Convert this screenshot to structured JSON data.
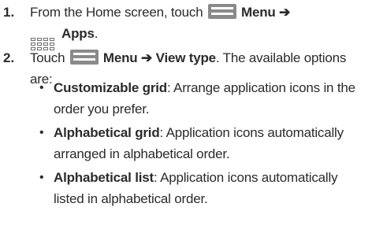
{
  "steps": [
    {
      "number": "1.",
      "text_before": "From the Home screen, touch",
      "menu_label": "Menu",
      "arrow": "➔",
      "apps_label": "Apps",
      "end": "."
    },
    {
      "number": "2.",
      "text_before": "Touch",
      "menu_label": "Menu",
      "arrow": "➔",
      "view_type": "View type",
      "text_after": ". The available options are:"
    }
  ],
  "options": [
    {
      "title": "Customizable grid",
      "desc": ": Arrange application icons in the order you prefer."
    },
    {
      "title": "Alphabetical grid",
      "desc": ": Application icons automatically arranged in alphabetical order."
    },
    {
      "title": "Alphabetical list",
      "desc": ": Application icons automatically listed in alphabetical order."
    }
  ],
  "icons": {
    "menu": "menu-icon",
    "apps": "apps-grid-icon",
    "bullet": "bullet-icon"
  }
}
